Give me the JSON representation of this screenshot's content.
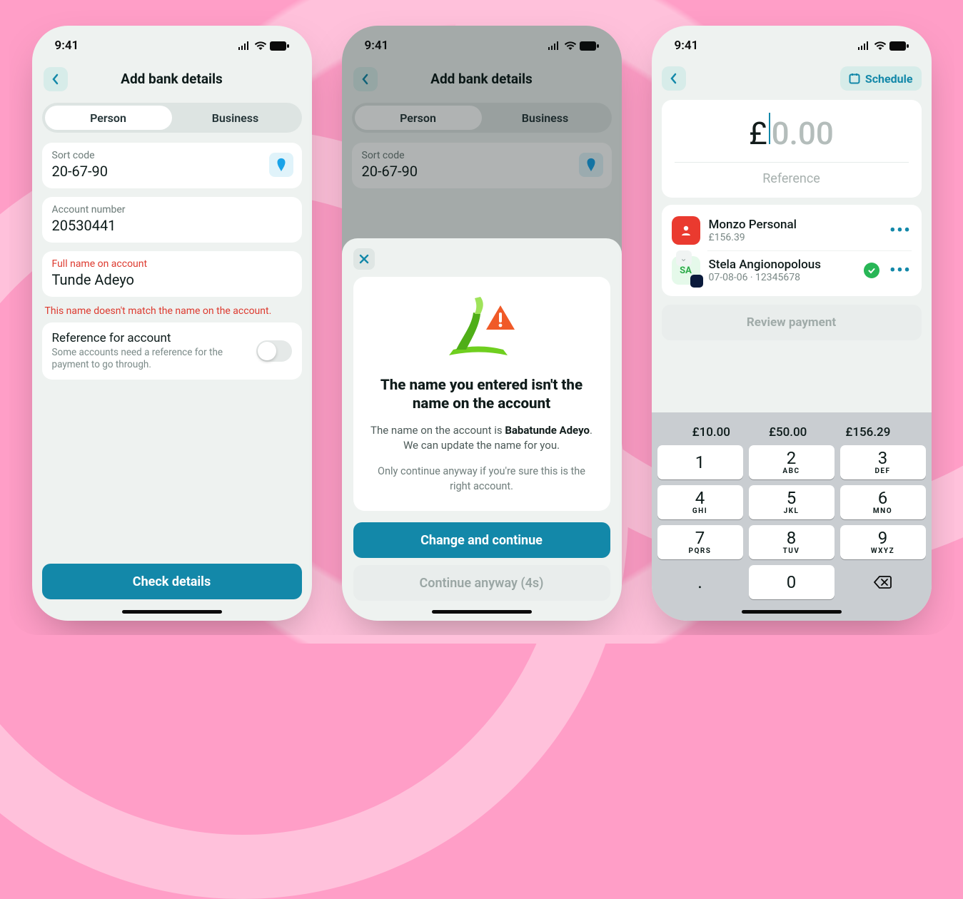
{
  "status": {
    "time": "9:41"
  },
  "screen1": {
    "title": "Add bank details",
    "tabs": {
      "person": "Person",
      "business": "Business"
    },
    "sort": {
      "label": "Sort code",
      "value": "20-67-90"
    },
    "account": {
      "label": "Account number",
      "value": "20530441"
    },
    "name": {
      "label": "Full name on account",
      "value": "Tunde Adeyo",
      "error": "This name doesn't match the name on the account."
    },
    "reference": {
      "title": "Reference for account",
      "subtitle": "Some accounts need a reference for the payment to go through."
    },
    "cta": "Check details"
  },
  "screen2": {
    "title": "Add bank details",
    "tabs": {
      "person": "Person",
      "business": "Business"
    },
    "sort": {
      "label": "Sort code",
      "value": "20-67-90"
    },
    "sheet": {
      "heading": "The name you entered isn't the name on the account",
      "body_pre": "The name on the account is ",
      "body_bold": "Babatunde Adeyo",
      "body_post": ". We can update the name for you.",
      "hint": "Only continue anyway if you're sure this is the right account.",
      "primary": "Change and continue",
      "secondary": "Continue anyway (4s)"
    }
  },
  "screen3": {
    "schedule": "Schedule",
    "currency": "£",
    "amount_placeholder": "0.00",
    "reference_placeholder": "Reference",
    "from": {
      "name": "Monzo Personal",
      "balance": "£156.39"
    },
    "to": {
      "name": "Stela Angionopolous",
      "meta": "07-08-06 · 12345678",
      "initials": "SA"
    },
    "review": "Review payment",
    "quick": [
      "£10.00",
      "£50.00",
      "£156.29"
    ],
    "keys": [
      {
        "n": "1",
        "l": ""
      },
      {
        "n": "2",
        "l": "ABC"
      },
      {
        "n": "3",
        "l": "DEF"
      },
      {
        "n": "4",
        "l": "GHI"
      },
      {
        "n": "5",
        "l": "JKL"
      },
      {
        "n": "6",
        "l": "MNO"
      },
      {
        "n": "7",
        "l": "PQRS"
      },
      {
        "n": "8",
        "l": "TUV"
      },
      {
        "n": "9",
        "l": "WXYZ"
      }
    ],
    "dot": ".",
    "zero": "0"
  }
}
